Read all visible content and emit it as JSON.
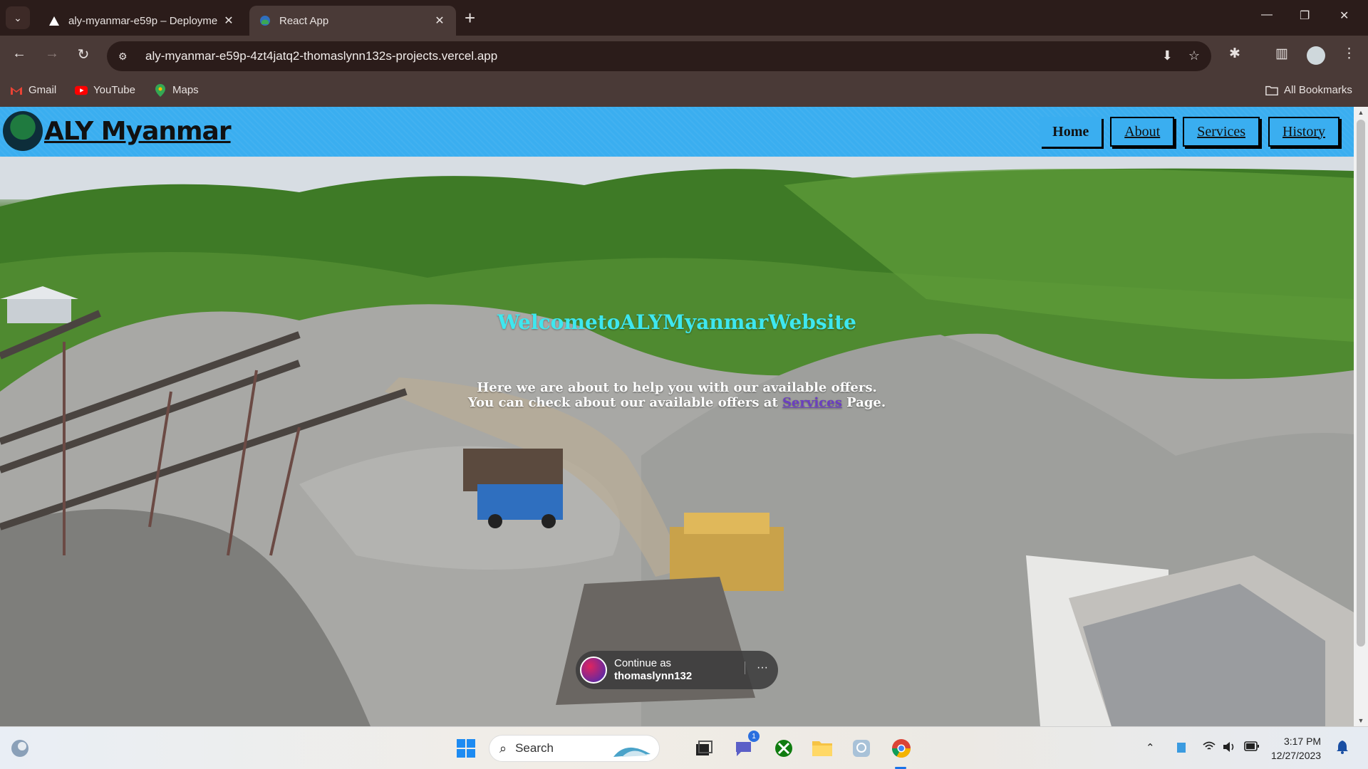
{
  "browser": {
    "tabs": [
      {
        "title": "aly-myanmar-e59p – Deployme",
        "active": false
      },
      {
        "title": "React App",
        "active": true
      }
    ],
    "url": "aly-myanmar-e59p-4zt4jatq2-thomaslynn132s-projects.vercel.app",
    "bookmarks": [
      {
        "label": "Gmail",
        "icon": "gmail-icon"
      },
      {
        "label": "YouTube",
        "icon": "youtube-icon"
      },
      {
        "label": "Maps",
        "icon": "maps-icon"
      }
    ],
    "all_bookmarks": "All Bookmarks"
  },
  "site": {
    "logo_text": "ALY Myanmar",
    "nav": {
      "home": "Home",
      "about": "About",
      "services": "Services",
      "history": "History"
    },
    "hero": {
      "title": "WelcometoALYMyanmarWebsite",
      "line1": "Here we are about to help you with our available offers.",
      "line2_before": "You can check about our available offers at ",
      "line2_link": "Services",
      "line2_after": " Page."
    }
  },
  "signin_prompt": {
    "line1": "Continue as",
    "user": "thomaslynn132"
  },
  "taskbar": {
    "search_label": "Search",
    "teams_badge": "1",
    "time": "3:17 PM",
    "date": "12/27/2023"
  },
  "colors": {
    "nav_bg": "#3aaef0",
    "hero_title": "#3ee7ef",
    "link": "#6b3fc0"
  }
}
